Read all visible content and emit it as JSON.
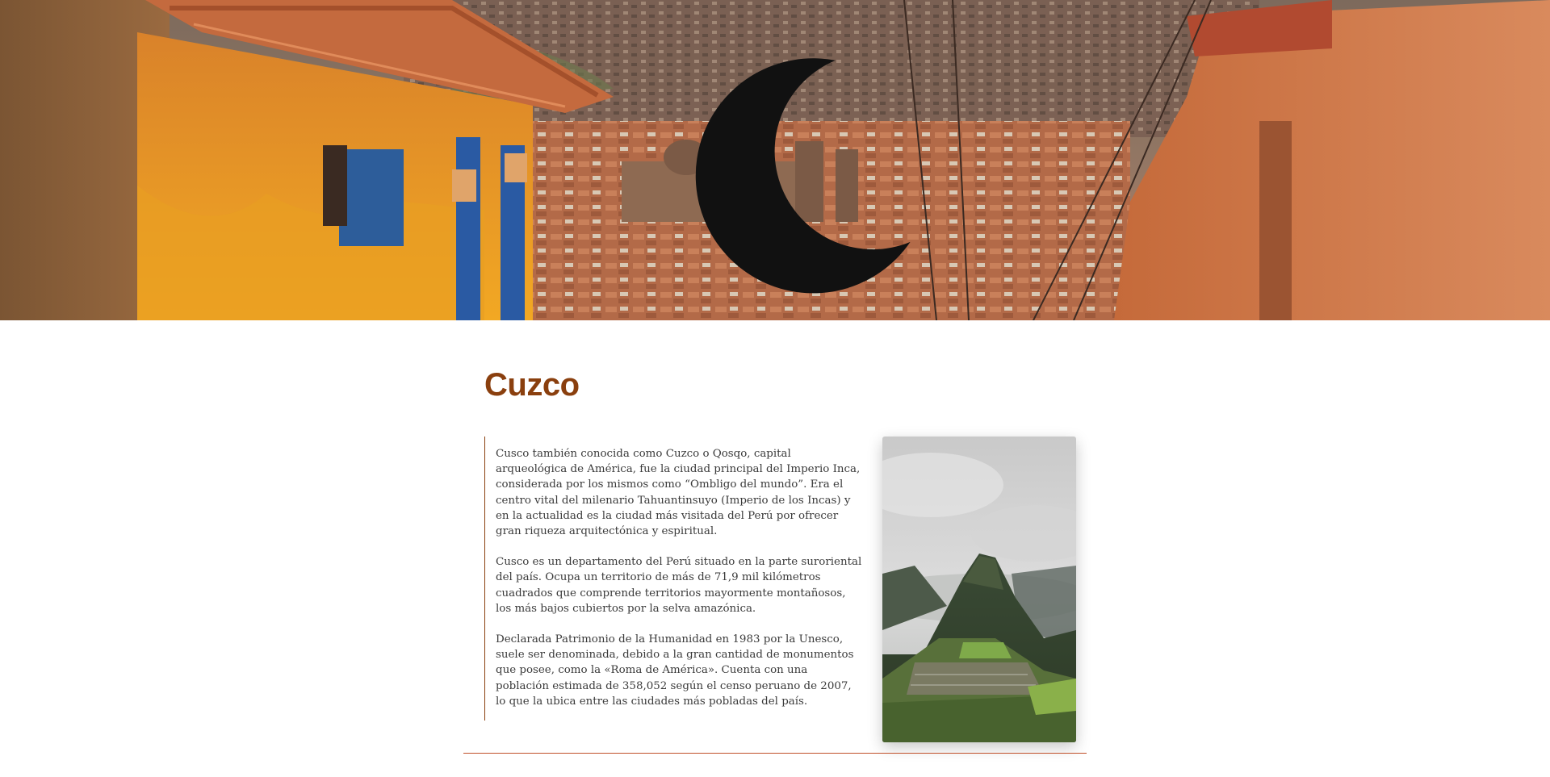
{
  "colors": {
    "accent": "#8a3f0e",
    "divider": "#c0502a",
    "text": "#3a3a3a"
  },
  "header": {
    "theme_toggle_icon": "moon-icon",
    "hero_image": "cusco-street-hero-image"
  },
  "main": {
    "title": "Cuzco",
    "paragraphs": [
      "Cusco también conocida como Cuzco o Qosqo, capital arqueológica de América, fue la ciudad principal del Imperio Inca, considerada por los mismos como “Ombligo del mundo”. Era el centro vital del milenario Tahuantinsuyo (Imperio de los Incas) y en la actualidad es la ciudad más visitada del Perú por ofrecer gran riqueza arquitectónica y espiritual.",
      "Cusco es un departamento del Perú situado en la parte suroriental del país. Ocupa un territorio de más de 71,9 mil kilómetros cuadrados que comprende territorios mayormente montañosos, los más bajos cubiertos por la selva amazónica.",
      "Declarada Patrimonio de la Humanidad en 1983 por la Unesco, suele ser denominada, debido a la gran cantidad de monumentos que posee, como la «Roma de América». Cuenta con una población estimada de 358,052 según el censo peruano de 2007, lo que la ubica entre las ciudades más pobladas del país."
    ],
    "side_image": "machu-picchu-image"
  }
}
